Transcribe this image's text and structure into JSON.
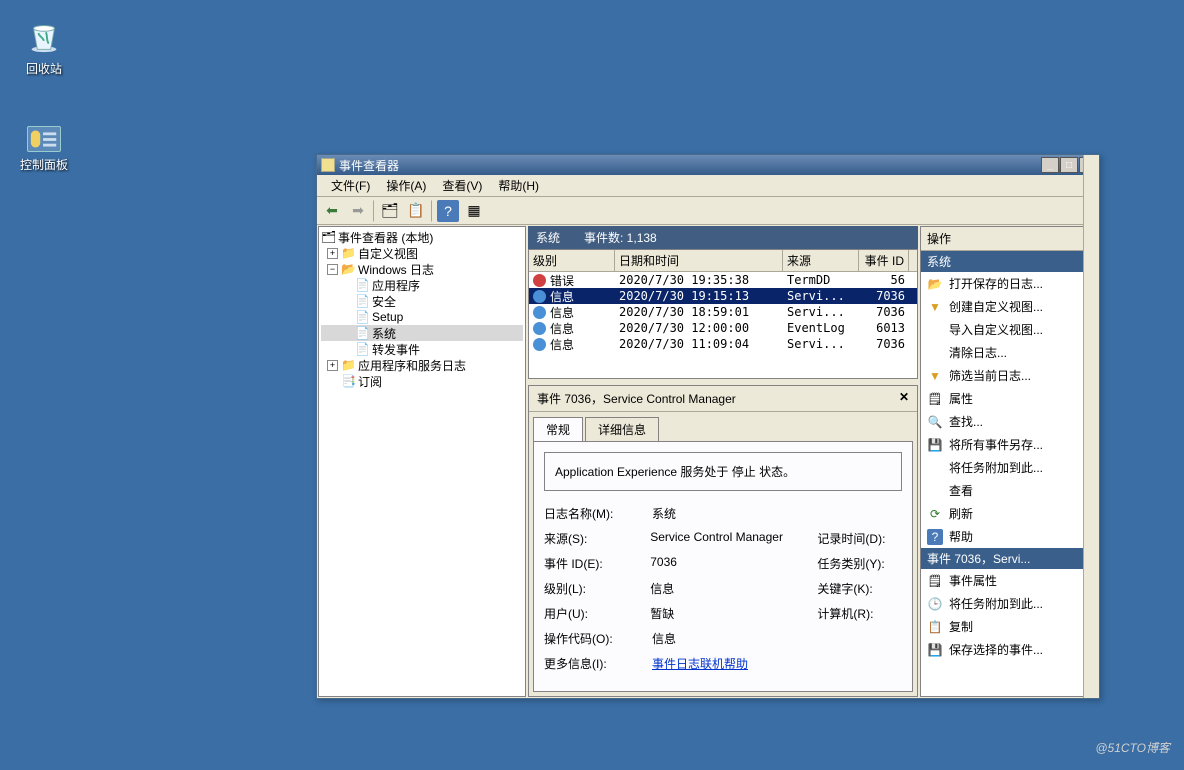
{
  "desktop": {
    "recycle": "回收站",
    "control_panel": "控制面板"
  },
  "window": {
    "title": "事件查看器"
  },
  "menu": {
    "file": "文件(F)",
    "action": "操作(A)",
    "view": "查看(V)",
    "help": "帮助(H)"
  },
  "tree": {
    "root": "事件查看器 (本地)",
    "custom_views": "自定义视图",
    "windows_logs": "Windows 日志",
    "application": "应用程序",
    "security": "安全",
    "setup": "Setup",
    "system": "系统",
    "forwarded": "转发事件",
    "app_service_logs": "应用程序和服务日志",
    "subscriptions": "订阅"
  },
  "listheader": {
    "title_a": "系统",
    "title_b": "事件数: 1,138",
    "col_level": "级别",
    "col_datetime": "日期和时间",
    "col_source": "来源",
    "col_eventid": "事件 ID"
  },
  "events": [
    {
      "level": "错误",
      "icon": "err",
      "datetime": "2020/7/30 19:35:38",
      "source": "TermDD",
      "id": "56"
    },
    {
      "level": "信息",
      "icon": "info",
      "datetime": "2020/7/30 19:15:13",
      "source": "Servi...",
      "id": "7036",
      "sel": true
    },
    {
      "level": "信息",
      "icon": "info",
      "datetime": "2020/7/30 18:59:01",
      "source": "Servi...",
      "id": "7036"
    },
    {
      "level": "信息",
      "icon": "info",
      "datetime": "2020/7/30 12:00:00",
      "source": "EventLog",
      "id": "6013"
    },
    {
      "level": "信息",
      "icon": "info",
      "datetime": "2020/7/30 11:09:04",
      "source": "Servi...",
      "id": "7036"
    }
  ],
  "detail": {
    "header": "事件 7036，Service Control Manager",
    "tabs": {
      "general": "常规",
      "details": "详细信息"
    },
    "message": "Application Experience 服务处于 停止 状态。",
    "labels": {
      "logname": "日志名称(M):",
      "source": "来源(S):",
      "eventid": "事件 ID(E):",
      "level": "级别(L):",
      "user": "用户(U):",
      "opcode": "操作代码(O):",
      "moreinfo": "更多信息(I):",
      "logtime": "记录时间(D):",
      "taskcat": "任务类别(Y):",
      "keywords": "关键字(K):",
      "computer": "计算机(R):"
    },
    "values": {
      "logname": "系统",
      "source": "Service Control Manager",
      "eventid": "7036",
      "level": "信息",
      "user": "暂缺",
      "opcode": "信息",
      "moreinfo_link": "事件日志联机帮助"
    }
  },
  "actions": {
    "header": "操作",
    "section_system": "系统",
    "open_saved": "打开保存的日志...",
    "create_custom": "创建自定义视图...",
    "import_custom": "导入自定义视图...",
    "clear_log": "清除日志...",
    "filter_current": "筛选当前日志...",
    "properties": "属性",
    "find": "查找...",
    "save_all": "将所有事件另存...",
    "attach_task": "将任务附加到此...",
    "view": "查看",
    "refresh": "刷新",
    "help": "帮助",
    "section_event": "事件 7036，Servi...",
    "event_props": "事件属性",
    "attach_task2": "将任务附加到此...",
    "copy": "复制",
    "save_selected": "保存选择的事件..."
  },
  "watermark": "@51CTO博客"
}
